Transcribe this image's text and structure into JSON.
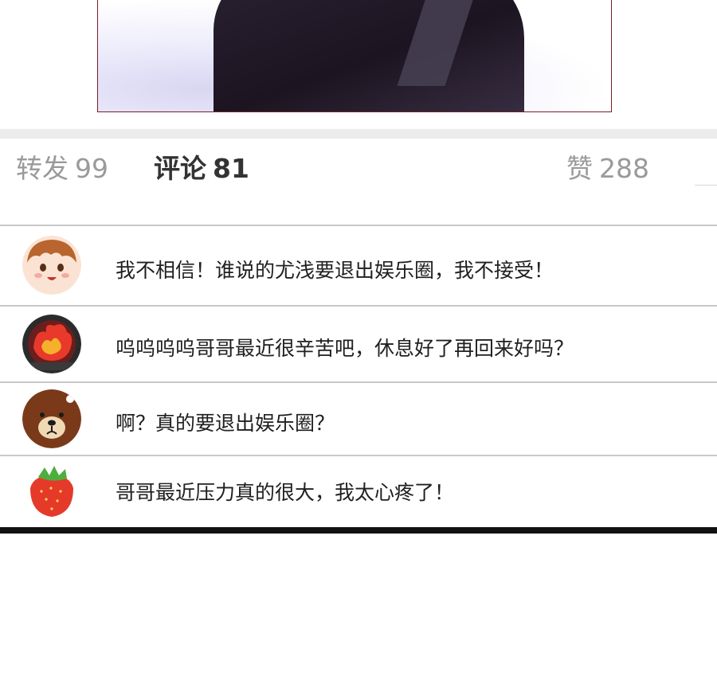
{
  "stats": {
    "repost_label": "转发",
    "repost_count": "99",
    "comment_label": "评论",
    "comment_count": "81",
    "like_label": "赞",
    "like_count": "288"
  },
  "comments": [
    {
      "avatar": "boy-avatar",
      "text": "我不相信！谁说的尤浅要退出娱乐圈，我不接受！"
    },
    {
      "avatar": "fire-emblem-avatar",
      "text": "呜呜呜呜哥哥最近很辛苦吧，休息好了再回来好吗？"
    },
    {
      "avatar": "bear-avatar",
      "text": "啊？真的要退出娱乐圈？"
    },
    {
      "avatar": "strawberry-avatar",
      "text": "哥哥最近压力真的很大，我太心疼了！"
    }
  ]
}
